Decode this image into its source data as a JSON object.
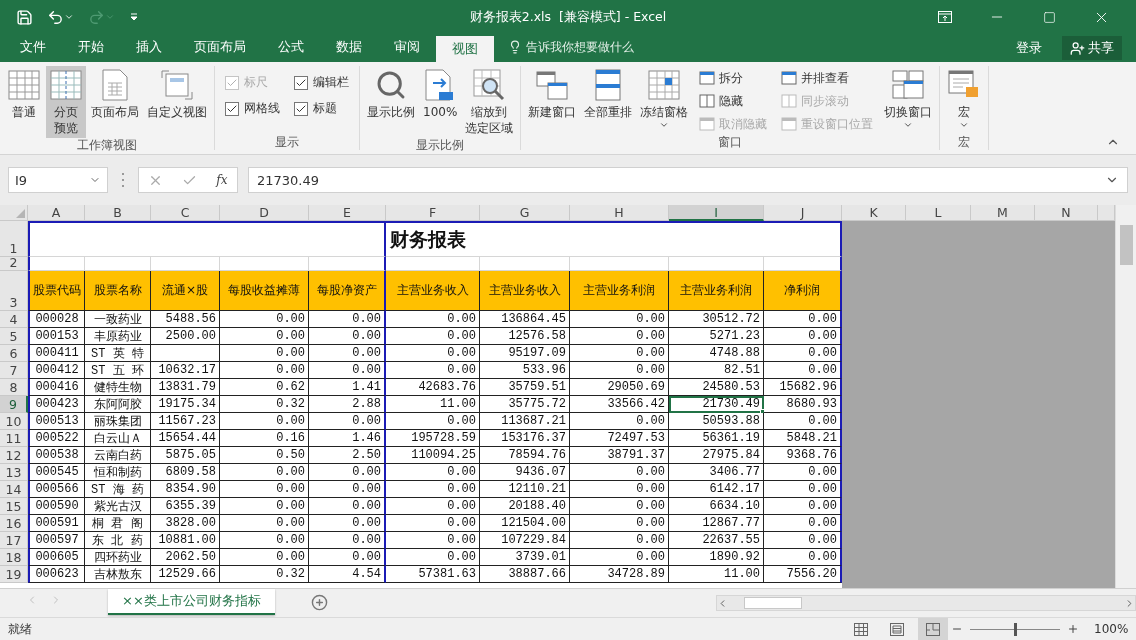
{
  "title_bar": {
    "title": "财务报表2.xls  [兼容模式] - Excel"
  },
  "menu_tabs": [
    {
      "label": "文件",
      "selected": false
    },
    {
      "label": "开始",
      "selected": false
    },
    {
      "label": "插入",
      "selected": false
    },
    {
      "label": "页面布局",
      "selected": false
    },
    {
      "label": "公式",
      "selected": false
    },
    {
      "label": "数据",
      "selected": false
    },
    {
      "label": "审阅",
      "selected": false
    },
    {
      "label": "视图",
      "selected": true
    }
  ],
  "tell_me": {
    "placeholder": "告诉我你想要做什么"
  },
  "account": {
    "sign_in": "登录",
    "share": "共享"
  },
  "ribbon_groups": [
    {
      "title": "工作簿视图",
      "items": [
        {
          "kind": "large",
          "lines": [
            "普通"
          ],
          "selected": false
        },
        {
          "kind": "large",
          "lines": [
            "分页",
            "预览"
          ],
          "selected": true
        },
        {
          "kind": "large",
          "lines": [
            "页面布局"
          ],
          "selected": false
        },
        {
          "kind": "large",
          "lines": [
            "自定义视图"
          ],
          "selected": false
        }
      ]
    },
    {
      "title": "显示",
      "items": [
        {
          "kind": "check",
          "label": "标尺",
          "checked": true,
          "disabled": true
        },
        {
          "kind": "check",
          "label": "编辑栏",
          "checked": true,
          "disabled": false
        },
        {
          "kind": "check",
          "label": "网格线",
          "checked": true,
          "disabled": false
        },
        {
          "kind": "check",
          "label": "标题",
          "checked": true,
          "disabled": false
        }
      ]
    },
    {
      "title": "显示比例",
      "items": [
        {
          "kind": "large",
          "lines": [
            "显示比例"
          ]
        },
        {
          "kind": "large",
          "lines": [
            "100%"
          ]
        },
        {
          "kind": "large",
          "lines": [
            "缩放到",
            "选定区域"
          ]
        }
      ]
    },
    {
      "title": "窗口",
      "items": [
        {
          "kind": "large",
          "lines": [
            "新建窗口"
          ]
        },
        {
          "kind": "large",
          "lines": [
            "全部重排"
          ]
        },
        {
          "kind": "large",
          "lines": [
            "冻结窗格"
          ],
          "dropdown": true
        },
        {
          "kind": "stack",
          "items": [
            {
              "label": "拆分",
              "disabled": false
            },
            {
              "label": "隐藏",
              "disabled": false
            },
            {
              "label": "取消隐藏",
              "disabled": true
            }
          ]
        },
        {
          "kind": "stack",
          "items": [
            {
              "label": "并排查看",
              "disabled": false
            },
            {
              "label": "同步滚动",
              "disabled": true
            },
            {
              "label": "重设窗口位置",
              "disabled": true
            }
          ]
        },
        {
          "kind": "large",
          "lines": [
            "切换窗口"
          ],
          "dropdown": true
        }
      ]
    },
    {
      "title": "宏",
      "items": [
        {
          "kind": "large",
          "lines": [
            "宏"
          ],
          "dropdown": true
        }
      ]
    }
  ],
  "formula_bar": {
    "name_box": "I9",
    "function_label": "fx",
    "formula": "21730.49"
  },
  "sheet": {
    "columns": [
      {
        "label": "A",
        "selected": false
      },
      {
        "label": "B",
        "selected": false
      },
      {
        "label": "C",
        "selected": false
      },
      {
        "label": "D",
        "selected": false
      },
      {
        "label": "E",
        "selected": false
      },
      {
        "label": "F",
        "selected": false
      },
      {
        "label": "G",
        "selected": false
      },
      {
        "label": "H",
        "selected": false
      },
      {
        "label": "I",
        "selected": true
      },
      {
        "label": "J",
        "selected": false
      },
      {
        "label": "K",
        "selected": false
      },
      {
        "label": "L",
        "selected": false
      },
      {
        "label": "M",
        "selected": false
      },
      {
        "label": "N",
        "selected": false
      }
    ],
    "title_row": {
      "number": "1",
      "selected": false,
      "title": "财务报表"
    },
    "blank_row": {
      "number": "2",
      "selected": false
    },
    "header_row": {
      "number": "3",
      "selected": false,
      "cells": [
        "股票代码",
        "股票名称",
        "流通×股",
        "每股收益摊薄",
        "每股净资产",
        "主营业务收入",
        "主营业务收入",
        "主营业务利润",
        "主营业务利润",
        "净利润"
      ]
    },
    "rows": [
      {
        "number": "4",
        "selected": false,
        "cells": [
          "000028",
          "一致药业",
          "5488.56",
          "0.00",
          "0.00",
          "0.00",
          "136864.45",
          "0.00",
          "30512.72",
          "0.00"
        ]
      },
      {
        "number": "5",
        "selected": false,
        "cells": [
          "000153",
          "丰原药业",
          "2500.00",
          "0.00",
          "0.00",
          "0.00",
          "12576.58",
          "0.00",
          "5271.23",
          "0.00"
        ]
      },
      {
        "number": "6",
        "selected": false,
        "cells": [
          "000411",
          "ST 英 特",
          null,
          "0.00",
          "0.00",
          "0.00",
          "95197.09",
          "0.00",
          "4748.88",
          "0.00"
        ]
      },
      {
        "number": "7",
        "selected": false,
        "cells": [
          "000412",
          "ST 五 环",
          "10632.17",
          "0.00",
          "0.00",
          "0.00",
          "533.96",
          "0.00",
          "82.51",
          "0.00"
        ]
      },
      {
        "number": "8",
        "selected": false,
        "cells": [
          "000416",
          "健特生物",
          "13831.79",
          "0.62",
          "1.41",
          "42683.76",
          "35759.51",
          "29050.69",
          "24580.53",
          "15682.96"
        ]
      },
      {
        "number": "9",
        "selected": true,
        "cells": [
          "000423",
          "东阿阿胶",
          "19175.34",
          "0.32",
          "2.88",
          "11.00",
          "35775.72",
          "33566.42",
          "21730.49",
          "8680.93"
        ]
      },
      {
        "number": "10",
        "selected": false,
        "cells": [
          "000513",
          "丽珠集团",
          "11567.23",
          "0.00",
          "0.00",
          "0.00",
          "113687.21",
          "0.00",
          "50593.88",
          "0.00"
        ]
      },
      {
        "number": "11",
        "selected": false,
        "cells": [
          "000522",
          "白云山Ａ",
          "15654.44",
          "0.16",
          "1.46",
          "195728.59",
          "153176.37",
          "72497.53",
          "56361.19",
          "5848.21"
        ]
      },
      {
        "number": "12",
        "selected": false,
        "cells": [
          "000538",
          "云南白药",
          "5875.05",
          "0.50",
          "2.50",
          "110094.25",
          "78594.76",
          "38791.37",
          "27975.84",
          "9368.76"
        ]
      },
      {
        "number": "13",
        "selected": false,
        "cells": [
          "000545",
          "恒和制药",
          "6809.58",
          "0.00",
          "0.00",
          "0.00",
          "9436.07",
          "0.00",
          "3406.77",
          "0.00"
        ]
      },
      {
        "number": "14",
        "selected": false,
        "cells": [
          "000566",
          "ST 海 药",
          "8354.90",
          "0.00",
          "0.00",
          "0.00",
          "12110.21",
          "0.00",
          "6142.17",
          "0.00"
        ]
      },
      {
        "number": "15",
        "selected": false,
        "cells": [
          "000590",
          "紫光古汉",
          "6355.39",
          "0.00",
          "0.00",
          "0.00",
          "20188.40",
          "0.00",
          "6634.10",
          "0.00"
        ]
      },
      {
        "number": "16",
        "selected": false,
        "cells": [
          "000591",
          "桐 君 阁",
          "3828.00",
          "0.00",
          "0.00",
          "0.00",
          "121504.00",
          "0.00",
          "12867.77",
          "0.00"
        ]
      },
      {
        "number": "17",
        "selected": false,
        "cells": [
          "000597",
          "东 北 药",
          "10881.00",
          "0.00",
          "0.00",
          "0.00",
          "107229.84",
          "0.00",
          "22637.55",
          "0.00"
        ]
      },
      {
        "number": "18",
        "selected": false,
        "cells": [
          "000605",
          "四环药业",
          "2062.50",
          "0.00",
          "0.00",
          "0.00",
          "3739.01",
          "0.00",
          "1890.92",
          "0.00"
        ]
      },
      {
        "number": "19",
        "selected": false,
        "cells": [
          "000623",
          "吉林敖东",
          "12529.66",
          "0.32",
          "4.54",
          "57381.63",
          "38887.66",
          "34728.89",
          "11.00",
          "7556.20"
        ]
      }
    ]
  },
  "sheet_tabs": [
    {
      "label": "××类上市公司财务指标",
      "selected": true
    }
  ],
  "status_bar": {
    "status": "就绪",
    "views": [
      {
        "selected": false
      },
      {
        "selected": false
      },
      {
        "selected": true
      }
    ],
    "zoom": {
      "level": 0.5,
      "reading": "100%"
    }
  }
}
